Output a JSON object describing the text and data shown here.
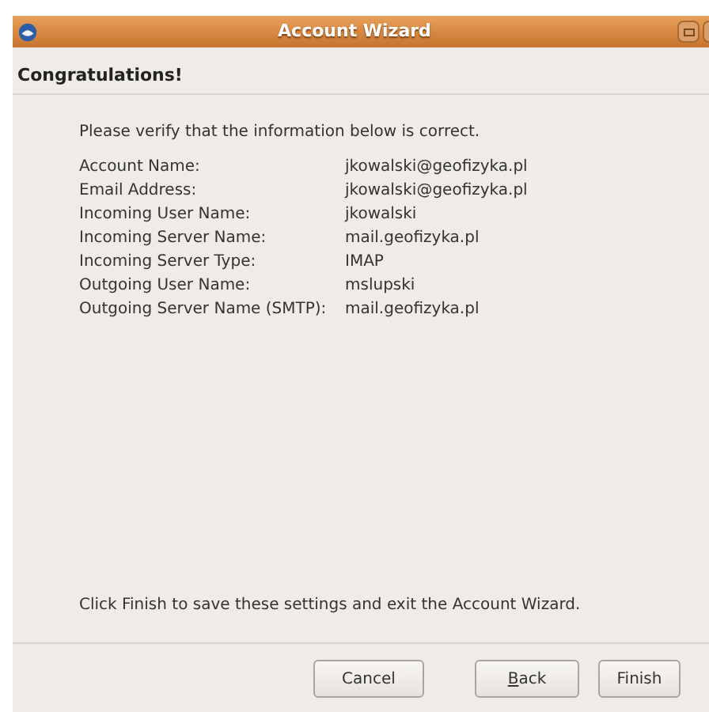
{
  "window": {
    "title": "Account Wizard"
  },
  "header": {
    "title": "Congratulations!"
  },
  "intro": "Please verify that the information below is correct.",
  "fields": [
    {
      "label": "Account Name:",
      "value": "jkowalski@geofizyka.pl"
    },
    {
      "label": "Email Address:",
      "value": "jkowalski@geofizyka.pl"
    },
    {
      "label": "Incoming User Name:",
      "value": "jkowalski"
    },
    {
      "label": "Incoming Server Name:",
      "value": "mail.geofizyka.pl"
    },
    {
      "label": "Incoming Server Type:",
      "value": "IMAP"
    },
    {
      "label": "Outgoing User Name:",
      "value": "mslupski"
    },
    {
      "label": "Outgoing Server Name (SMTP):",
      "value": "mail.geofizyka.pl"
    }
  ],
  "footer_text": "Click Finish to save these settings and exit the Account Wizard.",
  "buttons": [
    {
      "label": "Cancel"
    },
    {
      "label": "Back",
      "mnemonic_first_letter": true
    },
    {
      "label": "Finish"
    }
  ]
}
